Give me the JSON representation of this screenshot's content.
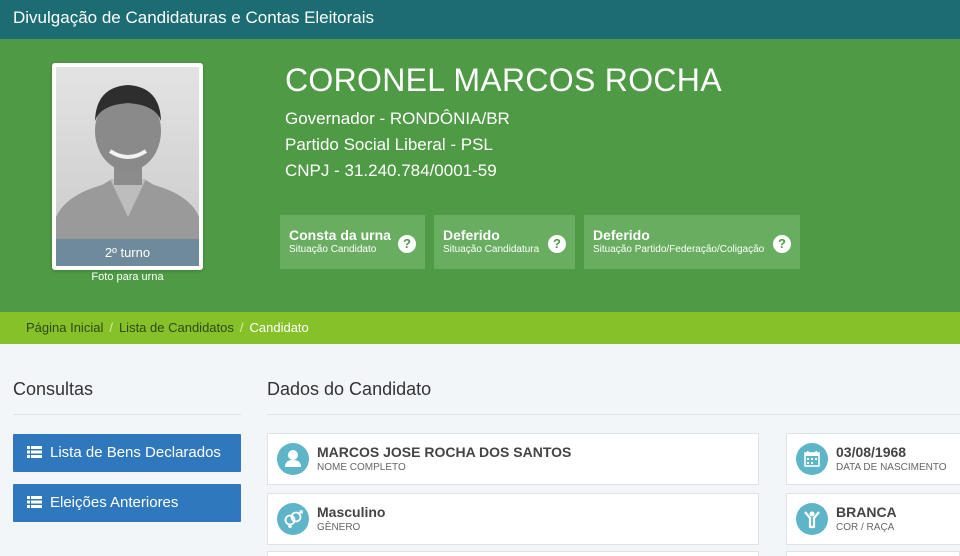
{
  "app_title": "Divulgação de Candidaturas e Contas Eleitorais",
  "candidate": {
    "photo_badge": "2º turno",
    "photo_caption": "Foto para urna",
    "name": "CORONEL MARCOS ROCHA",
    "office": "Governador - RONDÔNIA/BR",
    "party": "Partido Social Liberal - PSL",
    "cnpj": "CNPJ - 31.240.784/0001-59"
  },
  "statuses": [
    {
      "title": "Consta da urna",
      "subtitle": "Situação Candidato",
      "icon": "question-circle-icon"
    },
    {
      "title": "Deferido",
      "subtitle": "Situação Candidatura",
      "icon": "question-circle-icon"
    },
    {
      "title": "Deferido",
      "subtitle": "Situação Partido/Federação/Coligação",
      "icon": "question-circle-icon"
    }
  ],
  "breadcrumb": {
    "items": [
      "Página Inicial",
      "Lista de Candidatos",
      "Candidato"
    ],
    "separator": "/"
  },
  "sidebar": {
    "title": "Consultas",
    "buttons": [
      {
        "label": "Lista de Bens Declarados",
        "icon": "list-icon"
      },
      {
        "label": "Eleições Anteriores",
        "icon": "list-icon"
      }
    ]
  },
  "main": {
    "title": "Dados do Candidato",
    "fields": [
      {
        "value": "MARCOS JOSE ROCHA DOS SANTOS",
        "label": "NOME COMPLETO",
        "icon": "user-icon"
      },
      {
        "value": "03/08/1968",
        "label": "DATA DE NASCIMENTO",
        "icon": "calendar-icon"
      },
      {
        "value": "Masculino",
        "label": "GÊNERO",
        "icon": "gender-icon"
      },
      {
        "value": "BRANCA",
        "label": "COR / RAÇA",
        "icon": "person-raised-arms-icon"
      }
    ]
  },
  "colors": {
    "topbar": "#1b6d73",
    "hero": "#4f9a45",
    "status_box": "#69ad60",
    "breadcrumb_bar": "#86c12a",
    "button": "#2f78bd",
    "field_icon": "#5fb5c8"
  }
}
